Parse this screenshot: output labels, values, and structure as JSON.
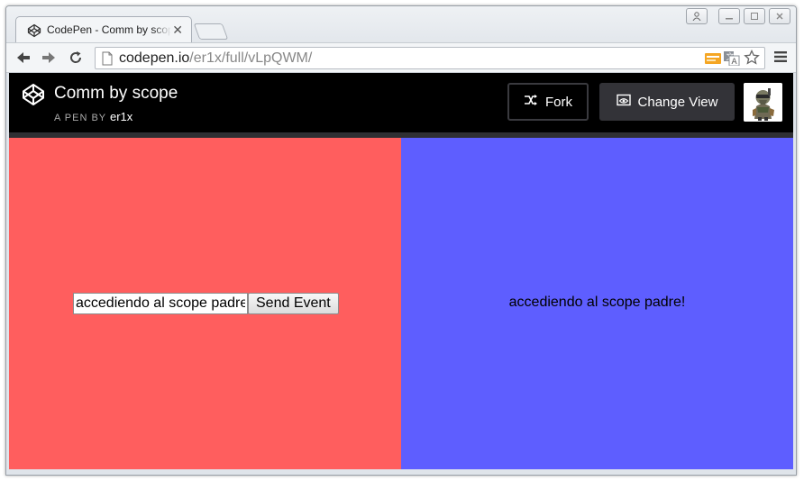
{
  "browser": {
    "tab": {
      "title": "CodePen - Comm by scope",
      "close_glyph": "✕",
      "favicon": "codepen-icon"
    },
    "address_bar": {
      "domain": "codepen.io",
      "path": "/er1x/full/vLpQWM/"
    },
    "icons": [
      "back-arrow-icon",
      "forward-arrow-icon",
      "reload-icon",
      "page-icon",
      "extension-icon",
      "translate-icon",
      "bookmark-star-icon",
      "menu-icon",
      "user-icon",
      "minimize-icon",
      "maximize-icon",
      "close-icon"
    ]
  },
  "codepen_header": {
    "pen_title": "Comm by scope",
    "byline_prefix": "A PEN BY",
    "author": "er1x",
    "fork_label": "Fork",
    "change_view_label": "Change View"
  },
  "content": {
    "input_value": "accediendo al scope padre!",
    "send_button_label": "Send Event",
    "message_text": "accediendo al scope padre!"
  },
  "colors": {
    "left_pane": "#ff5e5e",
    "right_pane": "#5e5eff",
    "header": "#000000"
  }
}
